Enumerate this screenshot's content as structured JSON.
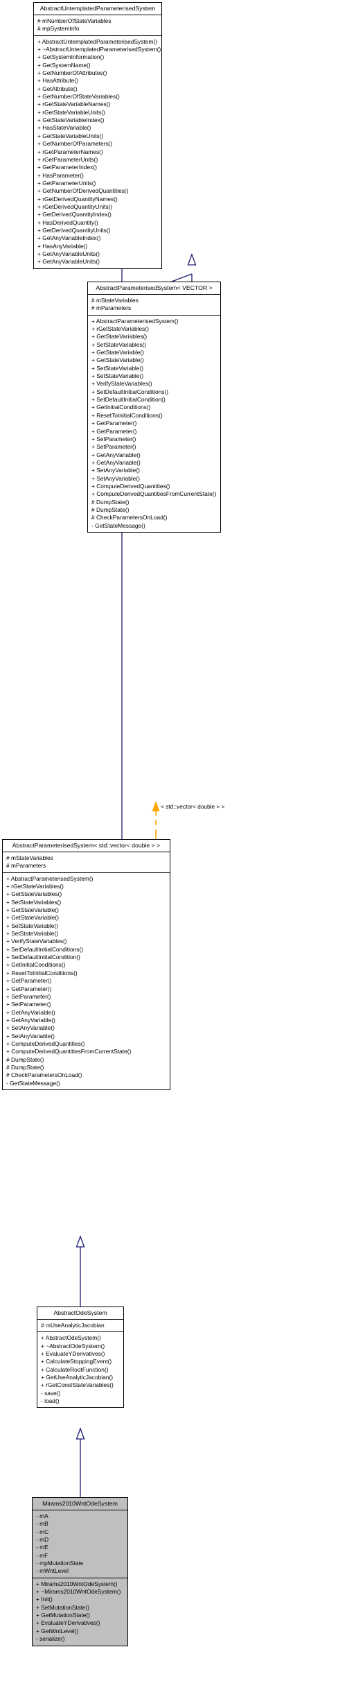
{
  "diagram": {
    "kind": "uml-class-inheritance-diagram",
    "colors": {
      "inheritance_edge": "#191970",
      "template_edge": "#ffa500",
      "highlight_fill": "#bfbfbf",
      "box_border": "#000000",
      "background": "#ffffff"
    },
    "edge_labels": [
      {
        "id": "template-binding-label",
        "text": "< std::vector< double > >"
      }
    ],
    "classes": [
      {
        "id": "abstract-untemplated-parameterised-system",
        "title": "AbstractUntemplatedParameterisedSystem",
        "highlighted": false,
        "attributes": [
          "# mNumberOfStateVariables",
          "# mpSystemInfo"
        ],
        "operations": [
          "+ AbstractUntemplatedParameterisedSystem()",
          "+ ~AbstractUntemplatedParameterisedSystem()",
          "+ GetSystemInformation()",
          "+ GetSystemName()",
          "+ GetNumberOfAttributes()",
          "+ HasAttribute()",
          "+ GetAttribute()",
          "+ GetNumberOfStateVariables()",
          "+ rGetStateVariableNames()",
          "+ rGetStateVariableUnits()",
          "+ GetStateVariableIndex()",
          "+ HasStateVariable()",
          "+ GetStateVariableUnits()",
          "+ GetNumberOfParameters()",
          "+ rGetParameterNames()",
          "+ rGetParameterUnits()",
          "+ GetParameterIndex()",
          "+ HasParameter()",
          "+ GetParameterUnits()",
          "+ GetNumberOfDerivedQuantities()",
          "+ rGetDerivedQuantityNames()",
          "+ rGetDerivedQuantityUnits()",
          "+ GetDerivedQuantityIndex()",
          "+ HasDerivedQuantity()",
          "+ GetDerivedQuantityUnits()",
          "+ GetAnyVariableIndex()",
          "+ HasAnyVariable()",
          "+ GetAnyVariableUnits()",
          "+ GetAnyVariableUnits()"
        ]
      },
      {
        "id": "abstract-parameterised-system-vector",
        "title": "AbstractParameterisedSystem< VECTOR >",
        "highlighted": false,
        "attributes": [
          "# mStateVariables",
          "# mParameters"
        ],
        "operations": [
          "+ AbstractParameterisedSystem()",
          "+ rGetStateVariables()",
          "+ GetStateVariables()",
          "+ SetStateVariables()",
          "+ GetStateVariable()",
          "+ GetStateVariable()",
          "+ SetStateVariable()",
          "+ SetStateVariable()",
          "+ VerifyStateVariables()",
          "+ SetDefaultInitialConditions()",
          "+ SetDefaultInitialCondition()",
          "+ GetInitialConditions()",
          "+ ResetToInitialConditions()",
          "+ GetParameter()",
          "+ GetParameter()",
          "+ SetParameter()",
          "+ SetParameter()",
          "+ GetAnyVariable()",
          "+ GetAnyVariable()",
          "+ SetAnyVariable()",
          "+ SetAnyVariable()",
          "+ ComputeDerivedQuantities()",
          "+ ComputeDerivedQuantitiesFromCurrentState()",
          "# DumpState()",
          "# DumpState()",
          "# CheckParametersOnLoad()",
          "- GetStateMessage()"
        ]
      },
      {
        "id": "abstract-parameterised-system-std-vector-double",
        "title": "AbstractParameterisedSystem< std::vector< double > >",
        "highlighted": false,
        "attributes": [
          "# mStateVariables",
          "# mParameters"
        ],
        "operations": [
          "+ AbstractParameterisedSystem()",
          "+ rGetStateVariables()",
          "+ GetStateVariables()",
          "+ SetStateVariables()",
          "+ GetStateVariable()",
          "+ GetStateVariable()",
          "+ SetStateVariable()",
          "+ SetStateVariable()",
          "+ VerifyStateVariables()",
          "+ SetDefaultInitialConditions()",
          "+ SetDefaultInitialCondition()",
          "+ GetInitialConditions()",
          "+ ResetToInitialConditions()",
          "+ GetParameter()",
          "+ GetParameter()",
          "+ SetParameter()",
          "+ SetParameter()",
          "+ GetAnyVariable()",
          "+ GetAnyVariable()",
          "+ SetAnyVariable()",
          "+ SetAnyVariable()",
          "+ ComputeDerivedQuantities()",
          "+ ComputeDerivedQuantitiesFromCurrentState()",
          "# DumpState()",
          "# DumpState()",
          "# CheckParametersOnLoad()",
          "- GetStateMessage()"
        ]
      },
      {
        "id": "abstract-ode-system",
        "title": "AbstractOdeSystem",
        "highlighted": false,
        "attributes": [
          "# mUseAnalyticJacobian"
        ],
        "operations": [
          "+ AbstractOdeSystem()",
          "+ ~AbstractOdeSystem()",
          "+ EvaluateYDerivatives()",
          "+ CalculateStoppingEvent()",
          "+ CalculateRootFunction()",
          "+ GetUseAnalyticJacobian()",
          "+ rGetConstStateVariables()",
          "- save()",
          "- load()"
        ]
      },
      {
        "id": "mirams-2010-wnt-ode-system",
        "title": "Mirams2010WntOdeSystem",
        "highlighted": true,
        "attributes": [
          "- mA",
          "- mB",
          "- mC",
          "- mD",
          "- mE",
          "- mF",
          "- mpMutationState",
          "- mWntLevel"
        ],
        "operations": [
          "+ Mirams2010WntOdeSystem()",
          "+ ~Mirams2010WntOdeSystem()",
          "+ Init()",
          "+ SetMutationState()",
          "+ GetMutationState()",
          "+ EvaluateYDerivatives()",
          "+ GetWntLevel()",
          "- serialize()"
        ]
      }
    ]
  }
}
